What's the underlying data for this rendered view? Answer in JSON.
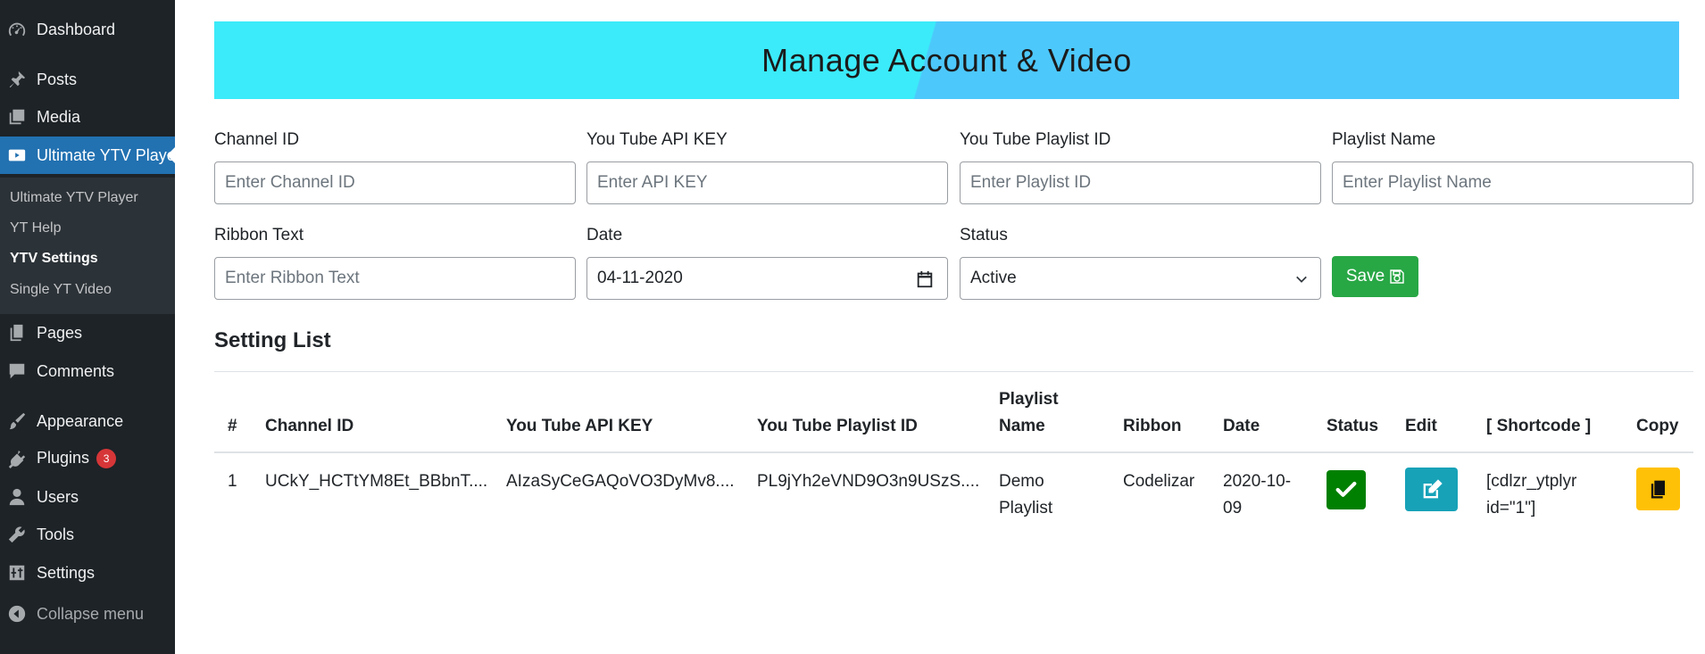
{
  "sidebar": {
    "items": [
      {
        "label": "Dashboard",
        "icon": "dashboard-icon"
      },
      {
        "label": "Posts",
        "icon": "pin-icon"
      },
      {
        "label": "Media",
        "icon": "media-icon"
      },
      {
        "label": "Ultimate YTV Player",
        "icon": "youtube-icon"
      },
      {
        "label": "Pages",
        "icon": "pages-icon"
      },
      {
        "label": "Comments",
        "icon": "comment-icon"
      },
      {
        "label": "Appearance",
        "icon": "brush-icon"
      },
      {
        "label": "Plugins",
        "icon": "plugin-icon",
        "badge": "3"
      },
      {
        "label": "Users",
        "icon": "user-icon"
      },
      {
        "label": "Tools",
        "icon": "wrench-icon"
      },
      {
        "label": "Settings",
        "icon": "settings-sliders-icon"
      },
      {
        "label": "Collapse menu",
        "icon": "collapse-icon"
      }
    ],
    "submenu": [
      "Ultimate YTV Player",
      "YT Help",
      "YTV Settings",
      "Single YT Video"
    ],
    "colors": {
      "bg": "#1d2327",
      "active": "#2271b1",
      "submenu_bg": "#2c3338",
      "badge": "#d63638"
    }
  },
  "banner": {
    "title": "Manage Account & Video"
  },
  "form": {
    "channel_id": {
      "label": "Channel ID",
      "placeholder": "Enter Channel ID"
    },
    "api_key": {
      "label": "You Tube API KEY",
      "placeholder": "Enter API KEY"
    },
    "playlist_id": {
      "label": "You Tube Playlist ID",
      "placeholder": "Enter Playlist ID"
    },
    "playlist_name": {
      "label": "Playlist Name",
      "placeholder": "Enter Playlist Name"
    },
    "ribbon_text": {
      "label": "Ribbon Text",
      "placeholder": "Enter Ribbon Text"
    },
    "date": {
      "label": "Date",
      "value": "04-11-2020"
    },
    "status": {
      "label": "Status",
      "value": "Active"
    },
    "save_label": "Save"
  },
  "settings_list": {
    "title": "Setting List",
    "headers": {
      "num": "#",
      "channel_id": "Channel ID",
      "api_key": "You Tube API KEY",
      "playlist_id": "You Tube Playlist ID",
      "playlist_name_1": "Playlist",
      "playlist_name_2": "Name",
      "ribbon": "Ribbon",
      "date": "Date",
      "status": "Status",
      "edit": "Edit",
      "shortcode": "[ Shortcode ]",
      "copy": "Copy"
    },
    "rows": [
      {
        "num": "1",
        "channel_id": "UCkY_HCTtYM8Et_BBbnT....",
        "api_key": "AIzaSyCeGAQoVO3DyMv8....",
        "playlist_id": "PL9jYh2eVND9O3n9USzS....",
        "playlist_name_1": "Demo",
        "playlist_name_2": "Playlist",
        "ribbon": "Codelizar",
        "date_1": "2020-10-",
        "date_2": "09",
        "shortcode_1": "[cdlzr_ytplyr",
        "shortcode_2": "id=\"1\"]"
      }
    ]
  },
  "colors": {
    "banner_left": "#3bebf9",
    "banner_right": "#4dc8fb",
    "save": "#28a745",
    "status_ok": "#008000",
    "edit": "#17a2b8",
    "copy": "#ffc107"
  }
}
